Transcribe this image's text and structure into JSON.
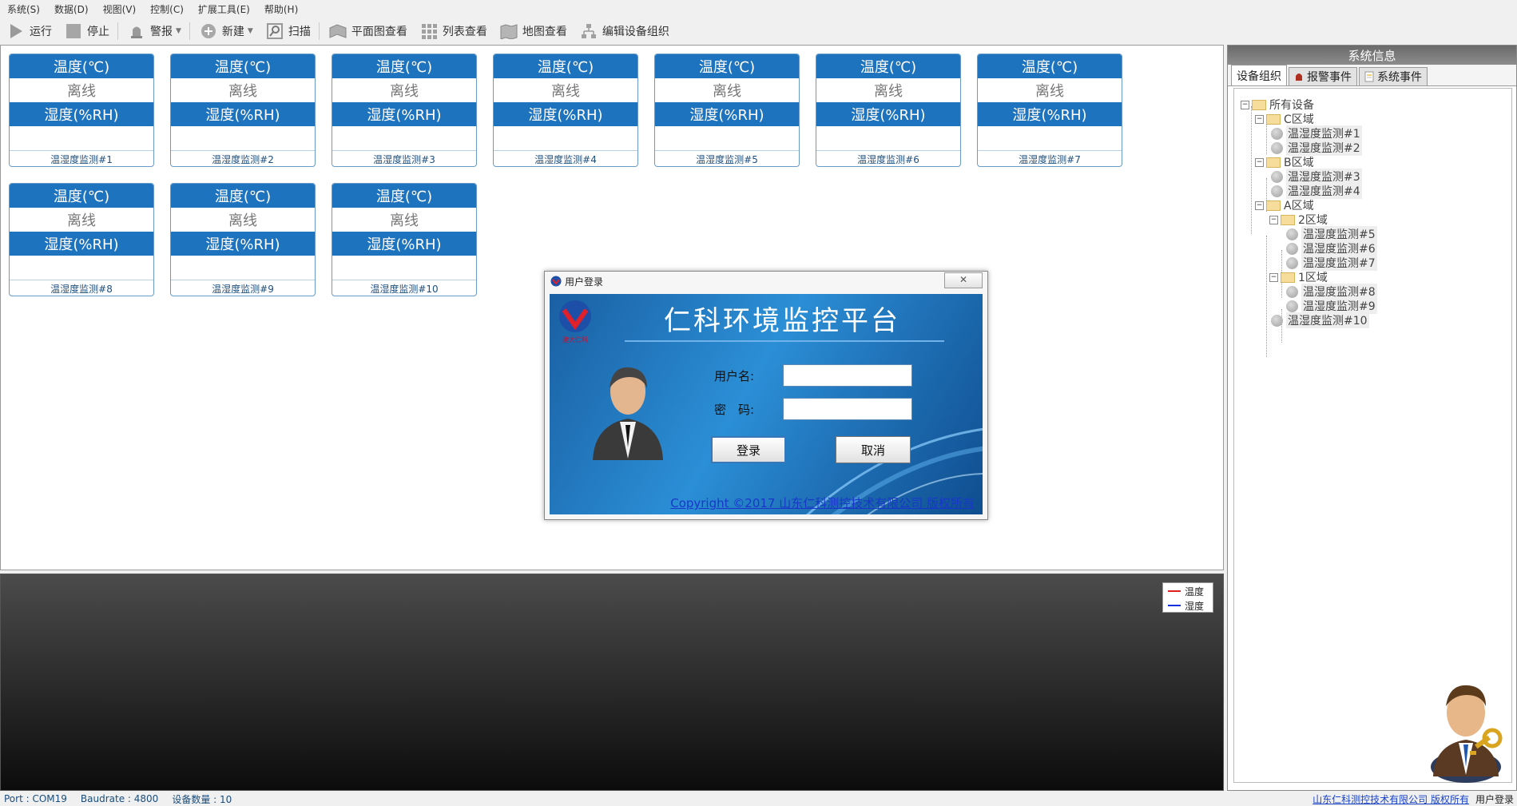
{
  "menu": [
    "系统(S)",
    "数据(D)",
    "视图(V)",
    "控制(C)",
    "扩展工具(E)",
    "帮助(H)"
  ],
  "toolbar": {
    "run": "运行",
    "stop": "停止",
    "alarm": "警报",
    "new": "新建",
    "scan": "扫描",
    "floorplan": "平面图查看",
    "list": "列表查看",
    "map": "地图查看",
    "edit_org": "编辑设备组织"
  },
  "devices": [
    {
      "temp_label": "温度(℃)",
      "temp_value": "离线",
      "hum_label": "湿度(%RH)",
      "hum_value": "",
      "name": "温湿度监测#1"
    },
    {
      "temp_label": "温度(℃)",
      "temp_value": "离线",
      "hum_label": "湿度(%RH)",
      "hum_value": "",
      "name": "温湿度监测#2"
    },
    {
      "temp_label": "温度(℃)",
      "temp_value": "离线",
      "hum_label": "湿度(%RH)",
      "hum_value": "",
      "name": "温湿度监测#3"
    },
    {
      "temp_label": "温度(℃)",
      "temp_value": "离线",
      "hum_label": "湿度(%RH)",
      "hum_value": "",
      "name": "温湿度监测#4"
    },
    {
      "temp_label": "温度(℃)",
      "temp_value": "离线",
      "hum_label": "湿度(%RH)",
      "hum_value": "",
      "name": "温湿度监测#5"
    },
    {
      "temp_label": "温度(℃)",
      "temp_value": "离线",
      "hum_label": "湿度(%RH)",
      "hum_value": "",
      "name": "温湿度监测#6"
    },
    {
      "temp_label": "温度(℃)",
      "temp_value": "离线",
      "hum_label": "湿度(%RH)",
      "hum_value": "",
      "name": "温湿度监测#7"
    },
    {
      "temp_label": "温度(℃)",
      "temp_value": "离线",
      "hum_label": "湿度(%RH)",
      "hum_value": "",
      "name": "温湿度监测#8"
    },
    {
      "temp_label": "温度(℃)",
      "temp_value": "离线",
      "hum_label": "湿度(%RH)",
      "hum_value": "",
      "name": "温湿度监测#9"
    },
    {
      "temp_label": "温度(℃)",
      "temp_value": "离线",
      "hum_label": "湿度(%RH)",
      "hum_value": "",
      "name": "温湿度监测#10"
    }
  ],
  "chart": {
    "legend": [
      {
        "label": "温度",
        "color": "#e02020"
      },
      {
        "label": "湿度",
        "color": "#1030e0"
      }
    ]
  },
  "sysinfo": {
    "title": "系统信息",
    "tabs": [
      "设备组织",
      "报警事件",
      "系统事件"
    ],
    "tree": {
      "root": "所有设备",
      "c_zone": "C区域",
      "b_zone": "B区域",
      "a_zone": "A区域",
      "zone2": "2区域",
      "zone1": "1区域",
      "d1": "温湿度监测#1",
      "d2": "温湿度监测#2",
      "d3": "温湿度监测#3",
      "d4": "温湿度监测#4",
      "d5": "温湿度监测#5",
      "d6": "温湿度监测#6",
      "d7": "温湿度监测#7",
      "d8": "温湿度监测#8",
      "d9": "温湿度监测#9",
      "d10": "温湿度监测#10"
    }
  },
  "status": {
    "port": "Port : COM19",
    "baudrate": "Baudrate : 4800",
    "count": "设备数量 : 10",
    "copyright": "山东仁科测控技术有限公司 版权所有",
    "login": "用户登录"
  },
  "login": {
    "title": "用户登录",
    "close": "✕",
    "brand": "仁科环境监控平台",
    "logo_caption": "建大仁科",
    "username_label": "用户名:",
    "password_label": "密　码:",
    "username_value": "",
    "password_value": "",
    "login_btn": "登录",
    "cancel_btn": "取消",
    "copyright": "Copyright ©2017 山东仁科测控技术有限公司 版权所有"
  }
}
